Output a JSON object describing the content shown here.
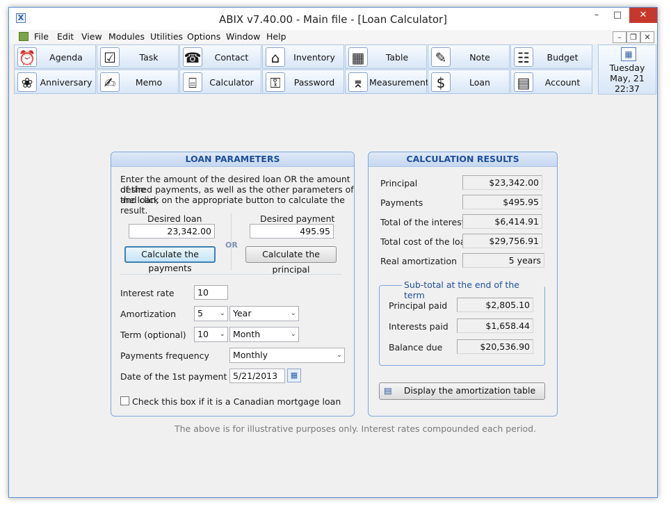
{
  "window": {
    "title": "ABIX v7.40.00  -  Main file - [Loan Calculator]",
    "app_icon": "abix-x-icon",
    "minimize_glyph": "–",
    "maximize_glyph": "□",
    "close_glyph": "✕"
  },
  "menu": {
    "items": [
      "File",
      "Edit",
      "View",
      "Modules",
      "Utilities",
      "Options",
      "Window",
      "Help"
    ],
    "mdi_minimize": "–",
    "mdi_restore": "❐",
    "mdi_close": "✕"
  },
  "toolbar": {
    "row1": [
      {
        "label": "Agenda",
        "icon": "clock-calendar-icon",
        "glyph": "⏰"
      },
      {
        "label": "Task",
        "icon": "checklist-icon",
        "glyph": "☑"
      },
      {
        "label": "Contact",
        "icon": "address-book-icon",
        "glyph": "☎"
      },
      {
        "label": "Inventory",
        "icon": "house-icon",
        "glyph": "⌂"
      },
      {
        "label": "Table",
        "icon": "table-pen-icon",
        "glyph": "▦"
      },
      {
        "label": "Note",
        "icon": "note-pen-icon",
        "glyph": "✎"
      },
      {
        "label": "Budget",
        "icon": "ledger-icon",
        "glyph": "☷"
      }
    ],
    "row2": [
      {
        "label": "Anniversary",
        "icon": "balloons-icon",
        "glyph": "❀"
      },
      {
        "label": "Memo",
        "icon": "memo-pencil-icon",
        "glyph": "✍"
      },
      {
        "label": "Calculator",
        "icon": "calculator-icon",
        "glyph": "⌸"
      },
      {
        "label": "Password",
        "icon": "password-pen-icon",
        "glyph": "⚿"
      },
      {
        "label": "Measurement",
        "icon": "ruler-icon",
        "glyph": "⌆"
      },
      {
        "label": "Loan",
        "icon": "money-icon",
        "glyph": "$"
      },
      {
        "label": "Account",
        "icon": "spreadsheet-icon",
        "glyph": "▤"
      }
    ],
    "date": {
      "day": "Tuesday",
      "date": "May, 21",
      "time": "22:37",
      "glyph": "▦"
    }
  },
  "loan_parameters": {
    "header": "LOAN PARAMETERS",
    "intro": [
      "Enter the amount of the desired loan OR the amount of the",
      "desired payments, as well as the other parameters of the loan,",
      "and click on the appropriate button to calculate the result."
    ],
    "desired_loan_label": "Desired loan",
    "desired_loan_value": "23,342.00",
    "desired_payment_label": "Desired payment",
    "desired_payment_value": "495.95",
    "or_label": "OR",
    "calc_payments_button": "Calculate the payments",
    "calc_principal_button": "Calculate the principal",
    "interest_rate_label": "Interest rate",
    "interest_rate_value": "10",
    "amortization_label": "Amortization",
    "amortization_value": "5",
    "amortization_unit": "Year",
    "term_label": "Term (optional)",
    "term_value": "10",
    "term_unit": "Month",
    "frequency_label": "Payments frequency",
    "frequency_value": "Monthly",
    "first_payment_label": "Date of the 1st payment",
    "first_payment_value": "5/21/2013",
    "canadian_checkbox_label": "Check this box if it is a Canadian mortgage loan",
    "dropdown_glyph": "⌄",
    "date_picker_glyph": "▦"
  },
  "calculation_results": {
    "header": "CALCULATION RESULTS",
    "rows": [
      {
        "label": "Principal",
        "value": "$23,342.00"
      },
      {
        "label": "Payments",
        "value": "$495.95"
      },
      {
        "label": "Total of the interests",
        "value": "$6,414.91"
      },
      {
        "label": "Total cost of the loan",
        "value": "$29,756.91"
      },
      {
        "label": "Real amortization",
        "value": "5 years"
      }
    ],
    "subtotal_title": "Sub-total at the end of the term",
    "subtotal_rows": [
      {
        "label": "Principal paid",
        "value": "$2,805.10"
      },
      {
        "label": "Interests paid",
        "value": "$1,658.44"
      },
      {
        "label": "Balance due",
        "value": "$20,536.90"
      }
    ],
    "amortization_button": "Display the amortization table",
    "amortization_button_glyph": "▤"
  },
  "footer_note": "The above is for illustrative purposes only.   Interest rates compounded each period."
}
